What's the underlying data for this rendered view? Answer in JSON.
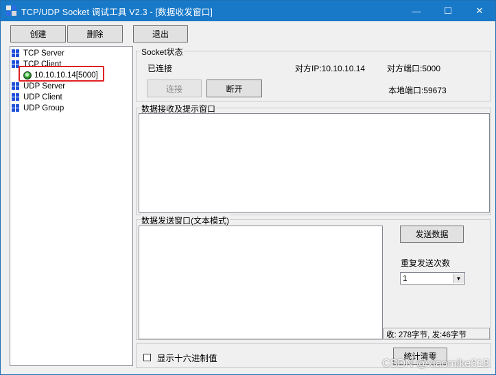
{
  "window": {
    "title": "TCP/UDP Socket 调试工具 V2.3 - [数据收发窗口]",
    "controls": {
      "minimize": "—",
      "maximize": "☐",
      "close": "✕"
    }
  },
  "toolbar": {
    "create_label": "创建",
    "delete_label": "删除",
    "exit_label": "退出"
  },
  "tree": {
    "tcp_server": "TCP Server",
    "tcp_client": "TCP Client",
    "tcp_client_child": "10.10.10.14[5000]",
    "udp_server": "UDP Server",
    "udp_client": "UDP Client",
    "udp_group": "UDP Group"
  },
  "socket_status": {
    "group_label": "Socket状态",
    "state": "已连接",
    "remote_ip": "对方IP:10.10.10.14",
    "remote_port": "对方端口:5000",
    "local_port": "本地端口:59673",
    "connect_label": "连接",
    "disconnect_label": "断开"
  },
  "receive": {
    "group_label": "数据接收及提示窗口",
    "content": ""
  },
  "send": {
    "group_label": "数据发送窗口(文本模式)",
    "content": "",
    "send_button": "发送数据",
    "repeat_label": "重复发送次数",
    "repeat_value": "1",
    "stats": "收: 278字节, 发:46字节"
  },
  "bottom": {
    "hex_checkbox_label": "显示十六进制值",
    "hex_checked": false,
    "reset_stats_label": "统计清零"
  },
  "watermark": "CSDN @xiaomike618",
  "colors": {
    "titlebar": "#1979c9",
    "highlight": "#e02020"
  }
}
